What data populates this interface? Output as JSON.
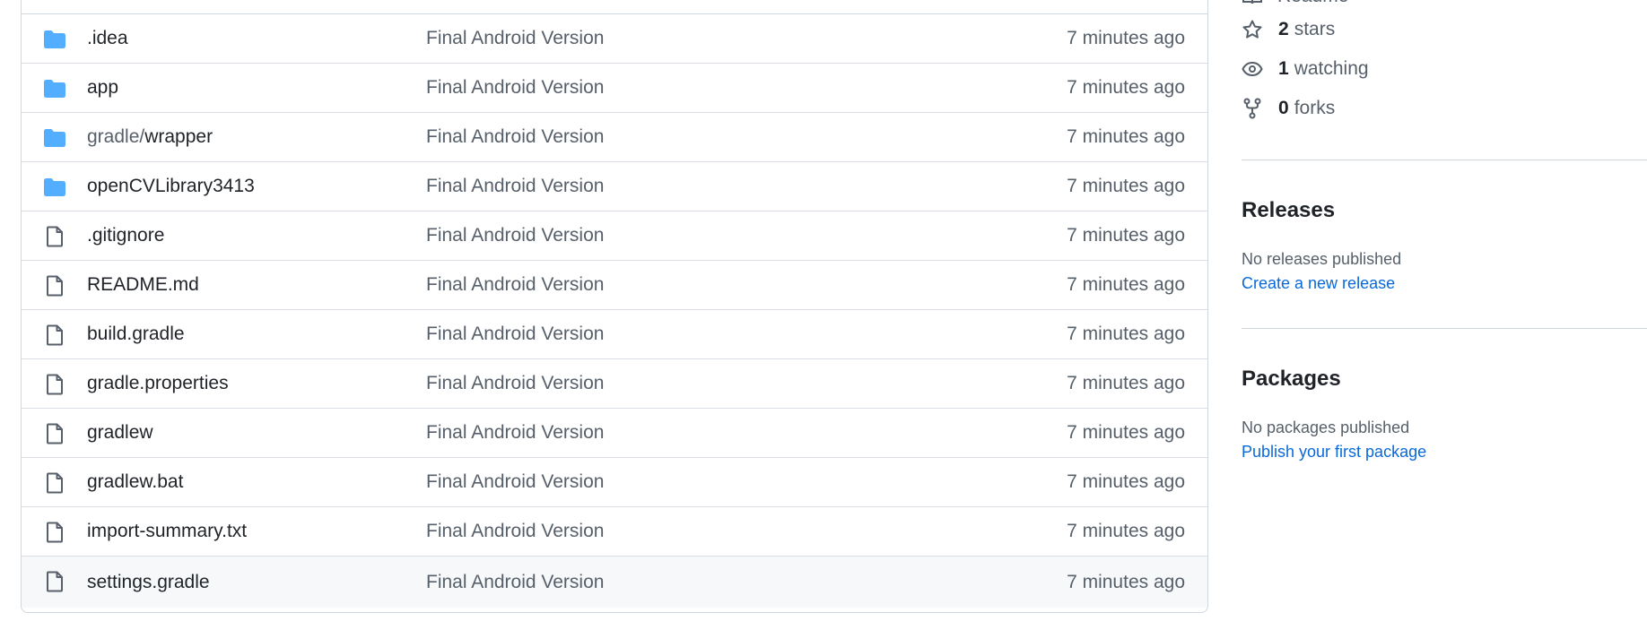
{
  "files": [
    {
      "type": "folder",
      "name": ".idea",
      "message": "Final Android Version",
      "age": "7 minutes ago"
    },
    {
      "type": "folder",
      "name": "app",
      "message": "Final Android Version",
      "age": "7 minutes ago"
    },
    {
      "type": "folder",
      "dir": "gradle/",
      "name": "wrapper",
      "message": "Final Android Version",
      "age": "7 minutes ago"
    },
    {
      "type": "folder",
      "name": "openCVLibrary3413",
      "message": "Final Android Version",
      "age": "7 minutes ago"
    },
    {
      "type": "file",
      "name": ".gitignore",
      "message": "Final Android Version",
      "age": "7 minutes ago"
    },
    {
      "type": "file",
      "name": "README.md",
      "message": "Final Android Version",
      "age": "7 minutes ago"
    },
    {
      "type": "file",
      "name": "build.gradle",
      "message": "Final Android Version",
      "age": "7 minutes ago"
    },
    {
      "type": "file",
      "name": "gradle.properties",
      "message": "Final Android Version",
      "age": "7 minutes ago"
    },
    {
      "type": "file",
      "name": "gradlew",
      "message": "Final Android Version",
      "age": "7 minutes ago"
    },
    {
      "type": "file",
      "name": "gradlew.bat",
      "message": "Final Android Version",
      "age": "7 minutes ago"
    },
    {
      "type": "file",
      "name": "import-summary.txt",
      "message": "Final Android Version",
      "age": "7 minutes ago"
    },
    {
      "type": "file",
      "name": "settings.gradle",
      "message": "Final Android Version",
      "age": "7 minutes ago"
    }
  ],
  "sidebar": {
    "readme_label": "Readme",
    "stars": {
      "count": "2",
      "label": "stars",
      "icon": "star-icon"
    },
    "watching": {
      "count": "1",
      "label": "watching",
      "icon": "eye-icon"
    },
    "forks": {
      "count": "0",
      "label": "forks",
      "icon": "fork-icon"
    },
    "releases": {
      "title": "Releases",
      "note": "No releases published",
      "link": "Create a new release"
    },
    "packages": {
      "title": "Packages",
      "note": "No packages published",
      "link": "Publish your first package"
    }
  },
  "colors": {
    "folder": "#54aeff",
    "link": "#0969da",
    "muted": "#57606a"
  }
}
